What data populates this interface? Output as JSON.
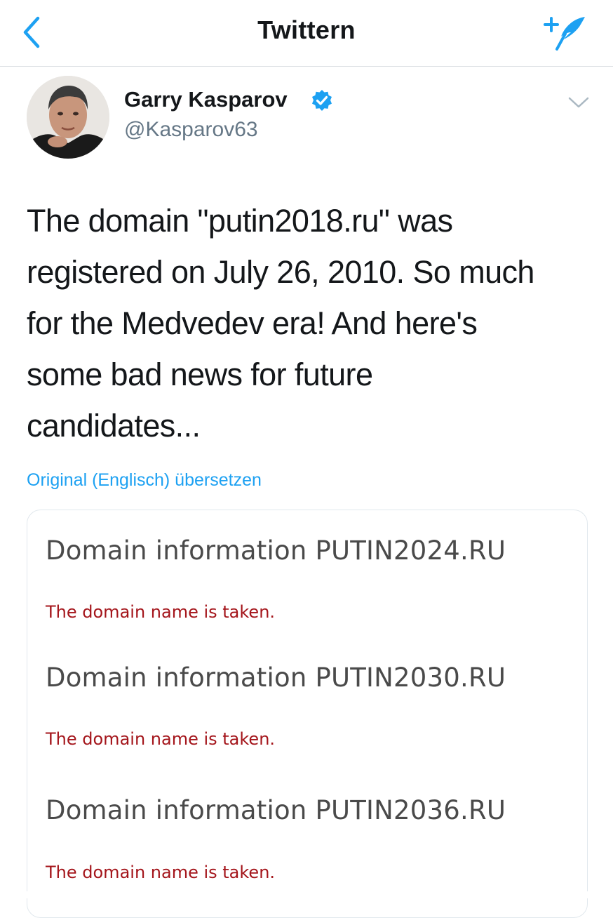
{
  "navbar": {
    "title": "Twittern",
    "back_icon": "chevron-left-icon",
    "compose_icon": "compose-tweet-icon",
    "accent_color": "#1da1f2"
  },
  "tweet": {
    "author_name": "Garry Kasparov",
    "handle": "@Kasparov63",
    "verified": true,
    "text_lines": [
      "The domain \"putin2018.ru\" was",
      "registered on July 26, 2010. So much",
      "for the Medvedev era! And here's",
      "some bad news for future",
      "candidates..."
    ],
    "translate_link": "Original (Englisch) übersetzen"
  },
  "media": {
    "entries": [
      {
        "heading": "Domain information PUTIN2024.RU",
        "status": "The domain name is taken."
      },
      {
        "heading": "Domain information PUTIN2030.RU",
        "status": "The domain name is taken."
      },
      {
        "heading": "Domain information PUTIN2036.RU",
        "status": "The domain name is taken."
      }
    ],
    "status_color": "#a4151b"
  }
}
